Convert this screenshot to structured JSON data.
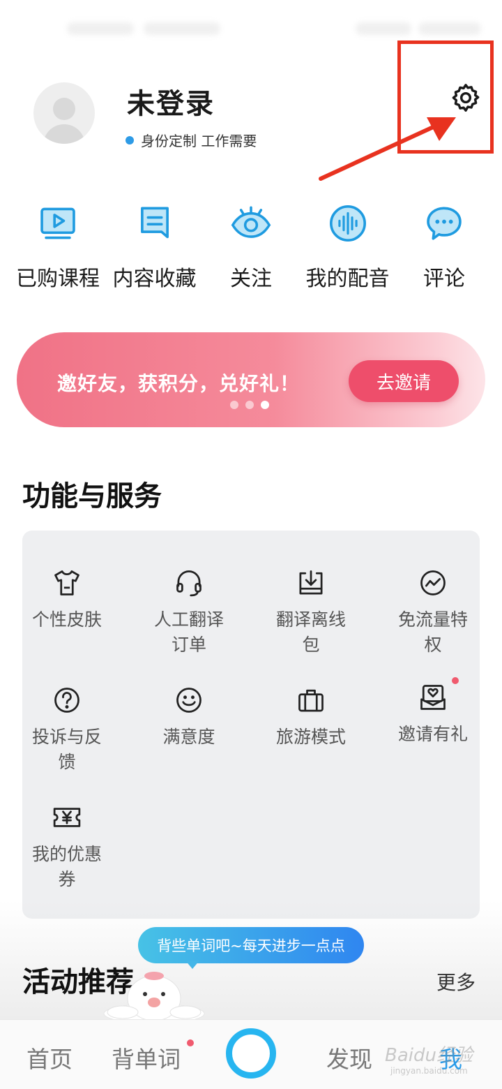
{
  "profile": {
    "username": "未登录",
    "tagline": "身份定制 工作需要"
  },
  "icons": {
    "settings": "gear-icon",
    "avatar": "user-avatar-icon"
  },
  "quick_actions": [
    {
      "label": "已购课程",
      "icon": "video-play-icon"
    },
    {
      "label": "内容收藏",
      "icon": "bookmark-icon"
    },
    {
      "label": "关注",
      "icon": "eye-icon"
    },
    {
      "label": "我的配音",
      "icon": "voice-wave-icon"
    },
    {
      "label": "评论",
      "icon": "chat-bubble-icon"
    }
  ],
  "banner": {
    "text": "邀好友，获积分，兑好礼！",
    "button": "去邀请",
    "page_count": 3,
    "active_page": 3
  },
  "services": {
    "title": "功能与服务",
    "items": [
      {
        "label": "个性皮肤",
        "icon": "tshirt-icon"
      },
      {
        "label": "人工翻译订单",
        "icon": "headset-icon"
      },
      {
        "label": "翻译离线包",
        "icon": "download-box-icon"
      },
      {
        "label": "免流量特权",
        "icon": "trend-circle-icon"
      },
      {
        "label": "投诉与反馈",
        "icon": "question-icon"
      },
      {
        "label": "满意度",
        "icon": "smile-icon"
      },
      {
        "label": "旅游模式",
        "icon": "suitcase-icon"
      },
      {
        "label": "邀请有礼",
        "icon": "gift-envelope-icon"
      },
      {
        "label": "我的优惠券",
        "icon": "coupon-icon"
      }
    ]
  },
  "activity": {
    "title": "活动推荐",
    "more": "更多"
  },
  "speech_bubble": "背些单词吧~每天进步一点点",
  "bottom_nav": {
    "home": "首页",
    "vocab": "背单词",
    "discover": "发现",
    "me": "我"
  },
  "watermark": {
    "text": "Baidu经验",
    "sub": "jingyan.baidu.com"
  },
  "colors": {
    "accent": "#2a9be8",
    "banner_pink": "#ee4e6b",
    "annotation_red": "#e8321f"
  }
}
